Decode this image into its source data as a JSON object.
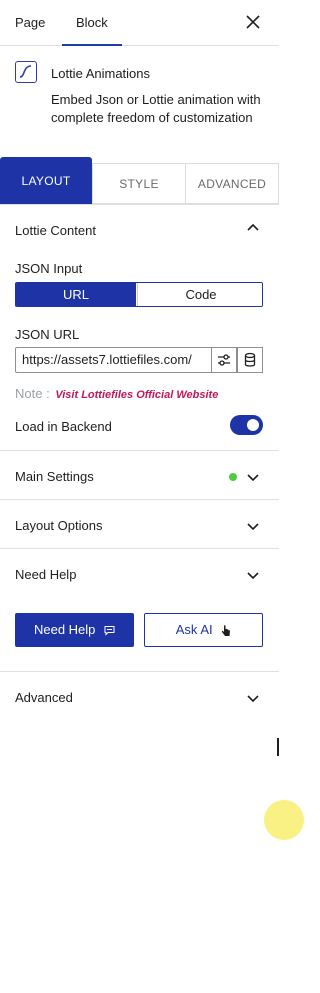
{
  "sidebar_tabs": [
    {
      "label": "Page",
      "active": false
    },
    {
      "label": "Block",
      "active": true
    }
  ],
  "close_icon": "close-icon",
  "block": {
    "icon": "lottie-curve-icon",
    "title": "Lottie Animations",
    "description": "Embed Json or Lottie animation with complete freedom of customization"
  },
  "layout_tabs": [
    {
      "label": "LAYOUT",
      "active": true
    },
    {
      "label": "STYLE",
      "active": false
    },
    {
      "label": "ADVANCED",
      "active": false
    }
  ],
  "lottie_content": {
    "title": "Lottie Content",
    "json_input_label": "JSON Input",
    "json_input_options": [
      "URL",
      "Code"
    ],
    "json_input_selected": "URL",
    "json_url_label": "JSON URL",
    "json_url_value": "https://assets7.lottiefiles.com/",
    "note_label": "Note :",
    "note_link": "Visit Lottiefiles Official Website",
    "load_backend_label": "Load in Backend",
    "load_backend_enabled": true
  },
  "panels": {
    "main_settings": "Main Settings",
    "layout_options": "Layout Options",
    "need_help": "Need Help",
    "advanced": "Advanced"
  },
  "help_buttons": {
    "need_help": "Need Help",
    "ask_ai": "Ask AI"
  },
  "colors": {
    "accent": "#1d33a6",
    "status_dot": "#4ccd3f",
    "note_link": "#c2185b"
  }
}
